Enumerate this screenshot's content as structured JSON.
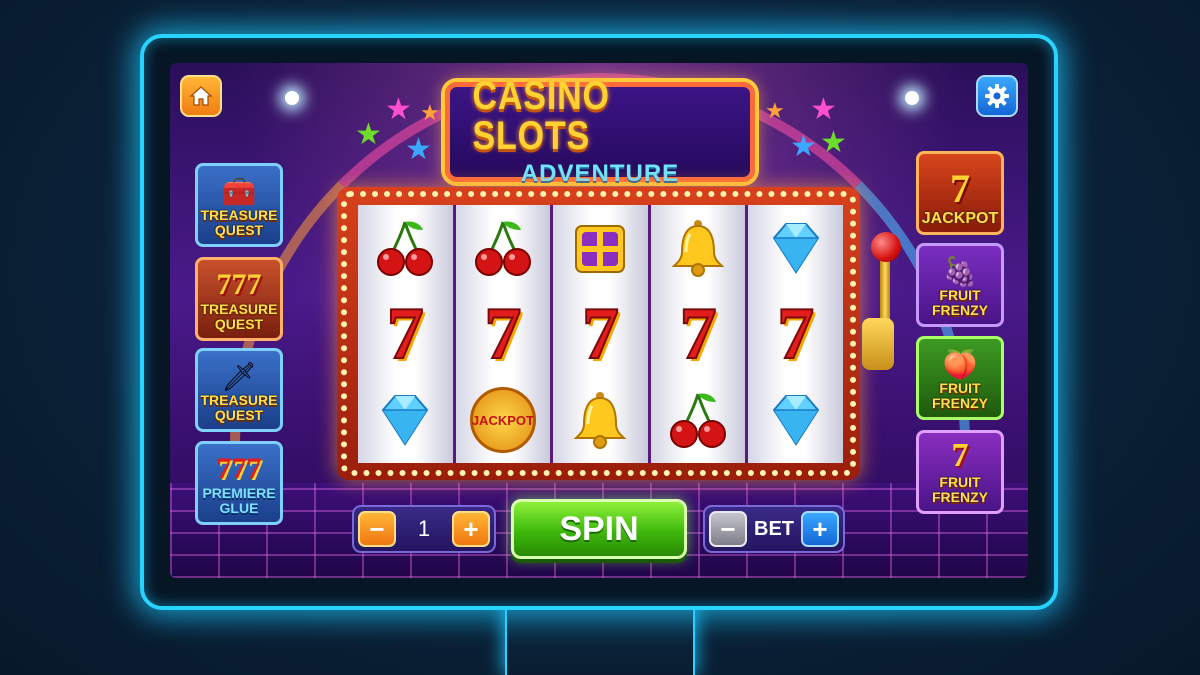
{
  "title": {
    "main": "CASINO SLOTS",
    "sub": "ADVENTURE"
  },
  "top_bar": {
    "home_icon": "home-icon",
    "settings_icon": "gear-icon"
  },
  "left_games": [
    {
      "label_line1": "TREASURE",
      "label_line2": "QUEST",
      "icon": "treasure-chest-icon"
    },
    {
      "label_line1": "TREASURE",
      "label_line2": "QUEST",
      "icon": "triple-seven-icon"
    },
    {
      "label_line1": "TREASURE",
      "label_line2": "QUEST",
      "icon": "gold-pot-sword-icon"
    },
    {
      "label_line1": "PREMIERE",
      "label_line2": "GLUE",
      "icon": "triple-seven-icon"
    }
  ],
  "right_games": [
    {
      "label_line1": "JACKPOT",
      "label_line2": "",
      "icon": "seven-stars-icon"
    },
    {
      "label_line1": "FRUIT",
      "label_line2": "FRENZY",
      "icon": "fruits-icon"
    },
    {
      "label_line1": "FRUIT",
      "label_line2": "FRENZY",
      "icon": "plum-icon"
    },
    {
      "label_line1": "FRUIT",
      "label_line2": "FRENZY",
      "icon": "seven-fruits-icon"
    }
  ],
  "reels": [
    [
      "cherry",
      "seven",
      "diamond"
    ],
    [
      "cherry",
      "seven",
      "jackpot"
    ],
    [
      "treasure-box",
      "seven",
      "bell"
    ],
    [
      "bell",
      "seven",
      "cherry"
    ],
    [
      "diamond",
      "seven",
      "diamond"
    ]
  ],
  "symbols": {
    "seven_text": "7",
    "jackpot_text": "JACKPOT"
  },
  "controls": {
    "lines_value": "1",
    "minus": "−",
    "plus": "+",
    "spin_label": "SPIN",
    "bet_label": "BET"
  },
  "colors": {
    "accent_cyan": "#27d3ff",
    "spin_green": "#3eb80c",
    "seven_red": "#e31c1c",
    "title_gold": "#ffd233"
  }
}
